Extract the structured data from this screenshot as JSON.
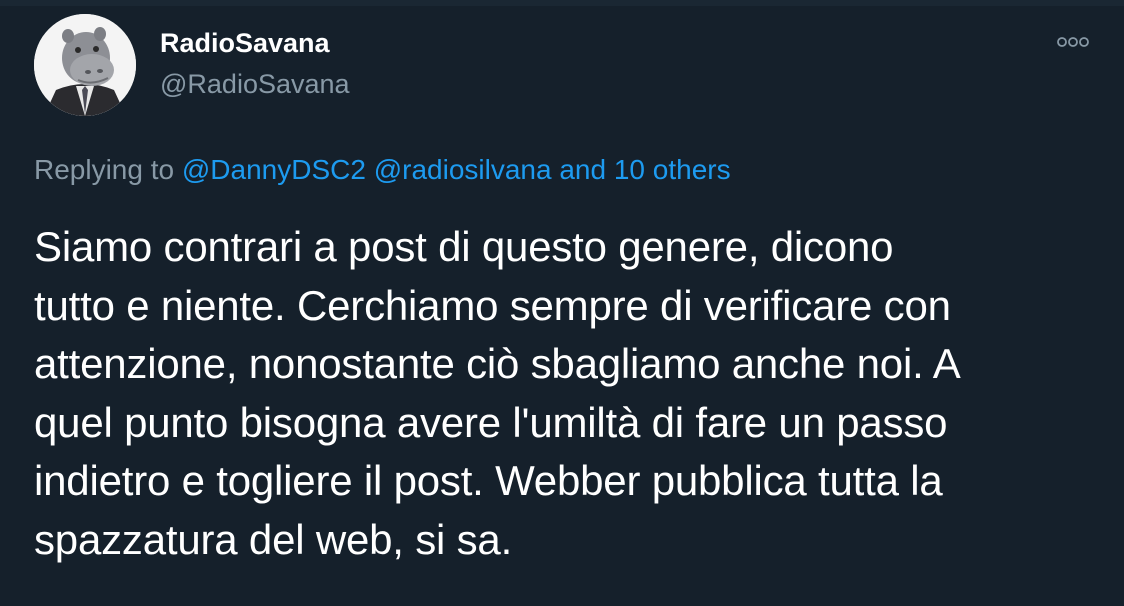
{
  "tweet": {
    "author": {
      "display_name": "RadioSavana",
      "handle": "@RadioSavana",
      "avatar_icon": "hippo-in-suit-avatar"
    },
    "more_icon": "more-options-icon",
    "reply": {
      "prefix": "Replying to ",
      "mentions": [
        "@DannyDSC2",
        "@radiosilvana"
      ],
      "suffix": "and 10 others"
    },
    "text_lines": [
      "Siamo contrari a post di questo genere, dicono",
      "tutto e niente. Cerchiamo sempre di verificare con",
      "attenzione, nonostante ciò sbagliamo anche noi. A",
      "quel punto bisogna avere l'umiltà di fare un passo",
      "indietro e togliere il post. Webber pubblica tutta la",
      "spazzatura del web, si sa."
    ]
  },
  "colors": {
    "background": "#15202b",
    "text": "#ffffff",
    "muted": "#8899a6",
    "link": "#1d9bf0"
  }
}
